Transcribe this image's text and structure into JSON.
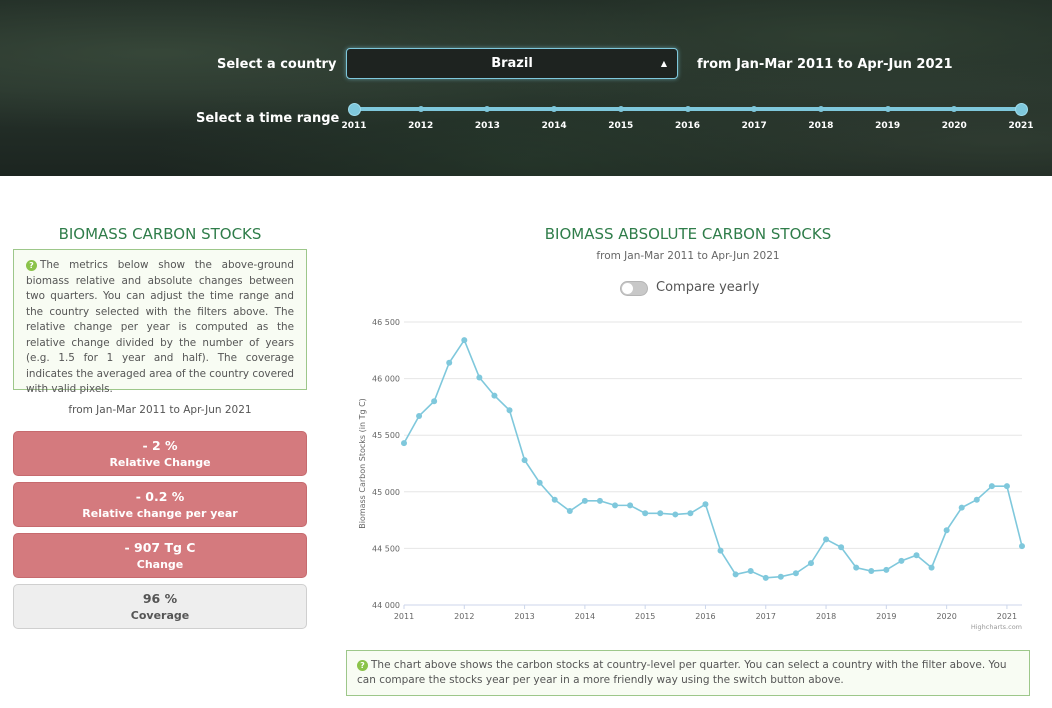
{
  "header": {
    "country_label": "Select a country",
    "country_value": "Brazil",
    "range_text": "from Jan-Mar 2011 to Apr-Jun 2021",
    "time_label": "Select a time range",
    "years": [
      "2011",
      "2012",
      "2013",
      "2014",
      "2015",
      "2016",
      "2017",
      "2018",
      "2019",
      "2020",
      "2021"
    ]
  },
  "left": {
    "title": "BIOMASS CARBON STOCKS",
    "info": "The metrics below show the above-ground biomass relative and absolute changes between two quarters. You can adjust the time range and the country selected with the filters above. The relative change per year is computed as the relative change divided by the number of years (e.g. 1.5 for 1 year and half). The coverage indicates the averaged area of the country covered with valid pixels.",
    "range": "from Jan-Mar 2011 to Apr-Jun 2021",
    "metrics": [
      {
        "value": "- 2 %",
        "label": "Relative Change"
      },
      {
        "value": "- 0.2 %",
        "label": "Relative change per year"
      },
      {
        "value": "- 907 Tg C",
        "label": "Change"
      },
      {
        "value": "96 %",
        "label": "Coverage"
      }
    ],
    "colors": {
      "negative": "#d47a7e",
      "neutral": "#eeeeee"
    }
  },
  "right": {
    "title": "BIOMASS ABSOLUTE CARBON STOCKS",
    "subtitle": "from Jan-Mar 2011 to Apr-Jun 2021",
    "toggle_label": "Compare yearly",
    "credit": "Highcharts.com",
    "bottom_info": "The chart above shows the carbon stocks at country-level per quarter. You can select a country with the filter above. You can compare the stocks year per year in a more friendly way using the switch button above."
  },
  "chart_data": {
    "type": "line",
    "ylabel": "Biomass Carbon Stocks (in Tg C)",
    "ylim": [
      44000,
      46500
    ],
    "yticks": [
      44000,
      44500,
      45000,
      45500,
      46000,
      46500
    ],
    "ytick_labels": [
      "44 000",
      "44 500",
      "45 000",
      "45 500",
      "46 000",
      "46 500"
    ],
    "xticks": [
      "2011",
      "2012",
      "2013",
      "2014",
      "2015",
      "2016",
      "2017",
      "2018",
      "2019",
      "2020",
      "2021"
    ],
    "color": "#7fc8dc",
    "x": [
      2011.0,
      2011.25,
      2011.5,
      2011.75,
      2012.0,
      2012.25,
      2012.5,
      2012.75,
      2013.0,
      2013.25,
      2013.5,
      2013.75,
      2014.0,
      2014.25,
      2014.5,
      2014.75,
      2015.0,
      2015.25,
      2015.5,
      2015.75,
      2016.0,
      2016.25,
      2016.5,
      2016.75,
      2017.0,
      2017.25,
      2017.5,
      2017.75,
      2018.0,
      2018.25,
      2018.5,
      2018.75,
      2019.0,
      2019.25,
      2019.5,
      2019.75,
      2020.0,
      2020.25,
      2020.5,
      2020.75,
      2021.0,
      2021.25
    ],
    "values": [
      45430,
      45670,
      45800,
      46140,
      46340,
      46010,
      45850,
      45720,
      45280,
      45080,
      44930,
      44830,
      44920,
      44920,
      44880,
      44880,
      44810,
      44810,
      44800,
      44810,
      44890,
      44480,
      44270,
      44300,
      44240,
      44250,
      44280,
      44370,
      44580,
      44510,
      44330,
      44300,
      44310,
      44390,
      44440,
      44330,
      44660,
      44860,
      44930,
      45050,
      45050,
      44520
    ]
  }
}
